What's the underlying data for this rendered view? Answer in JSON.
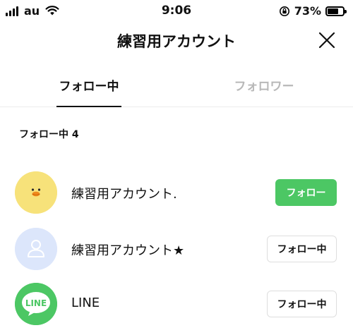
{
  "status_bar": {
    "carrier": "au",
    "time": "9:06",
    "battery_percent": "73%",
    "battery_level": 0.73
  },
  "header": {
    "title": "練習用アカウント",
    "close_icon": "close-icon"
  },
  "tabs": [
    {
      "label": "フォロー中",
      "active": true
    },
    {
      "label": "フォロワー",
      "active": false
    }
  ],
  "section": {
    "label": "フォロー中 4"
  },
  "list": [
    {
      "name": "練習用アカウント.",
      "avatar": "duck-avatar",
      "button_label": "フォロー"
    },
    {
      "name": "練習用アカウント★",
      "avatar": "default-person-avatar",
      "button_label": "フォロー中"
    },
    {
      "name": "LINE",
      "avatar": "line-logo-avatar",
      "avatar_text": "LINE",
      "button_label": "フォロー中"
    }
  ],
  "colors": {
    "accent_green": "#4cc764",
    "inactive_tab": "#b8b8b8",
    "duck_yellow": "#f7e27a",
    "default_avatar_bg": "#dce6fb",
    "line_green": "#4cc764"
  }
}
